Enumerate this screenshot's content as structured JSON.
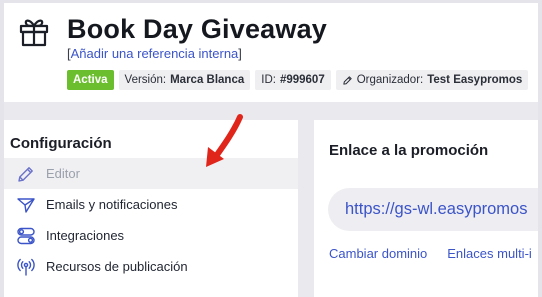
{
  "header": {
    "title": "Book Day Giveaway",
    "ref_open": "[",
    "ref_link": "Añadir una referencia interna",
    "ref_close": "]",
    "icon": "gift-icon",
    "badges": {
      "status": "Activa",
      "version_label": "Versión:",
      "version_value": "Marca Blanca",
      "id_label": "ID:",
      "id_value": "#999607",
      "organizer_label": "Organizador:",
      "organizer_value": "Test Easypromos"
    }
  },
  "config": {
    "title": "Configuración",
    "items": [
      {
        "label": "Editor",
        "icon": "pencil-icon",
        "selected": true
      },
      {
        "label": "Emails y notificaciones",
        "icon": "paper-plane-icon"
      },
      {
        "label": "Integraciones",
        "icon": "toggles-icon"
      },
      {
        "label": "Recursos de publicación",
        "icon": "broadcast-icon"
      }
    ]
  },
  "promo_link": {
    "title": "Enlace a la promoción",
    "url": "https://gs-wl.easypromos",
    "actions": [
      "Cambiar dominio",
      "Enlaces multi-i"
    ]
  },
  "colors": {
    "accent": "#3b54c8",
    "active_badge": "#6bbf2e",
    "annotation_arrow": "#e0251b",
    "band": "#e9e9ee"
  }
}
